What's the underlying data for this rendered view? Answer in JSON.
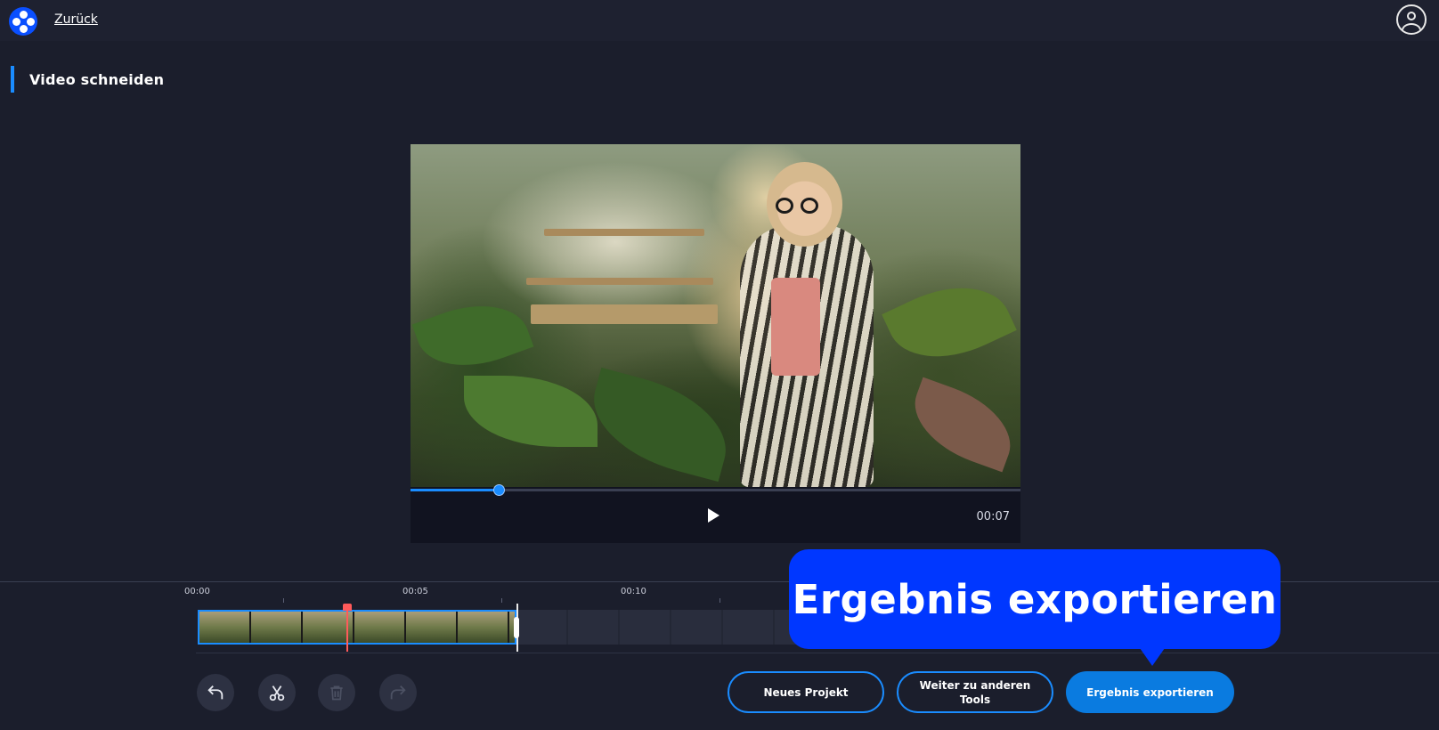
{
  "header": {
    "back_label": "Zurück"
  },
  "page": {
    "title": "Video schneiden"
  },
  "player": {
    "current_time": "00:07",
    "progress": 0.145
  },
  "timeline": {
    "ruler_labels": [
      "00:00",
      "00:05",
      "00:10"
    ]
  },
  "toolbar": {
    "undo_icon": "undo-icon",
    "cut_icon": "scissors-icon",
    "delete_icon": "trash-icon",
    "redo_icon": "redo-icon"
  },
  "actions": {
    "new_project_label": "Neues Projekt",
    "other_tools_label": "Weiter zu anderen Tools",
    "export_label": "Ergebnis exportieren"
  },
  "callout": {
    "text": "Ergebnis exportieren"
  },
  "colors": {
    "accent": "#1a8cff",
    "background": "#1b1e2c",
    "callout": "#0037ff",
    "playhead": "#ff5a5a"
  }
}
